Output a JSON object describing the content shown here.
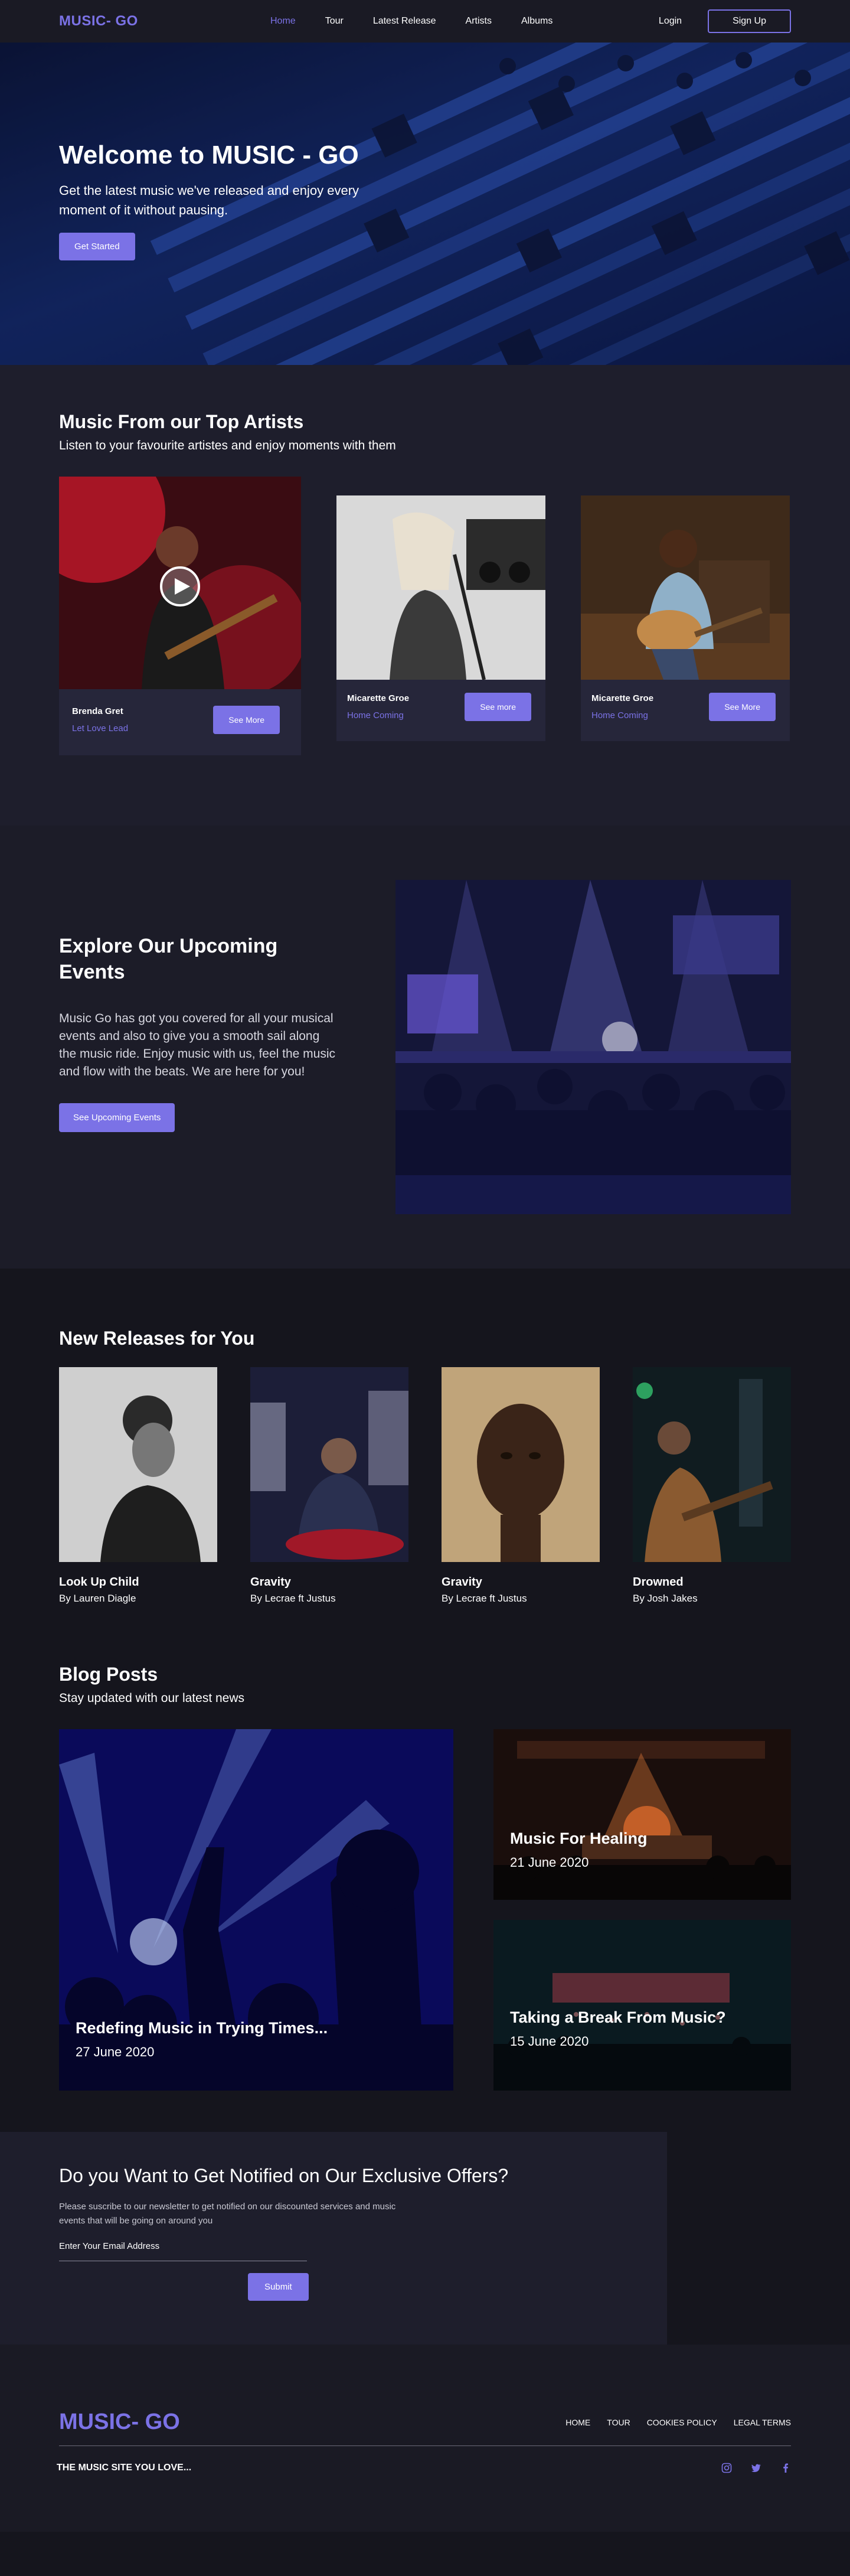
{
  "nav": {
    "logo": "MUSIC- GO",
    "links": [
      "Home",
      "Tour",
      "Latest Release",
      "Artists",
      "Albums"
    ],
    "login": "Login",
    "signup": "Sign Up"
  },
  "hero": {
    "title": "Welcome to MUSIC - GO",
    "subtitle": "Get the latest music  we've released and enjoy every moment of it without pausing.",
    "cta": "Get Started"
  },
  "artists": {
    "title": "Music From our Top Artists",
    "subtitle": "Listen  to your favourite artistes and enjoy moments with them",
    "cards": [
      {
        "name": "Brenda Gret",
        "song": "Let Love Lead",
        "button": "See More"
      },
      {
        "name": "Micarette Groe",
        "song": "Home Coming",
        "button": "See more"
      },
      {
        "name": "Micarette Groe",
        "song": "Home Coming",
        "button": "See More"
      }
    ]
  },
  "events": {
    "title": "Explore Our  Upcoming Events",
    "body": "Music Go has got you covered for all your musical events and also to give you a smooth sail along the music ride. Enjoy music with us, feel the music and flow with the beats. We are here for you!",
    "cta": "See Upcoming Events"
  },
  "releases": {
    "title": "New Releases for You",
    "items": [
      {
        "title": "Look Up Child",
        "artist": "By Lauren Diagle"
      },
      {
        "title": "Gravity",
        "artist": "By Lecrae ft Justus"
      },
      {
        "title": "Gravity",
        "artist": "By Lecrae ft Justus"
      },
      {
        "title": "Drowned",
        "artist": "By Josh Jakes"
      }
    ]
  },
  "blog": {
    "title": "Blog Posts",
    "subtitle": "Stay updated  with our latest news",
    "posts": [
      {
        "title": "Redefing Music in Trying Times...",
        "date": "27 June 2020"
      },
      {
        "title": "Music For Healing",
        "date": "21 June 2020"
      },
      {
        "title": "Taking a Break From Music?",
        "date": "15 June 2020"
      }
    ]
  },
  "newsletter": {
    "title": "Do you Want to Get Notified on Our Exclusive Offers?",
    "body": "Please suscribe to our newsletter to get  notified on our  discounted services and music events that will be going on around you",
    "email_label": "Enter Your Email  Address",
    "submit": "Submit"
  },
  "footer": {
    "logo": "MUSIC- GO",
    "links": [
      "HOME",
      "TOUR",
      "COOKIES POLICY",
      "LEGAL TERMS"
    ],
    "tagline": "THE MUSIC SITE YOU LOVE...",
    "socials": [
      "instagram-icon",
      "twitter-icon",
      "facebook-icon"
    ]
  },
  "colors": {
    "accent": "#7b72e6",
    "background": "#15151d",
    "panel": "#1e1e2c"
  }
}
